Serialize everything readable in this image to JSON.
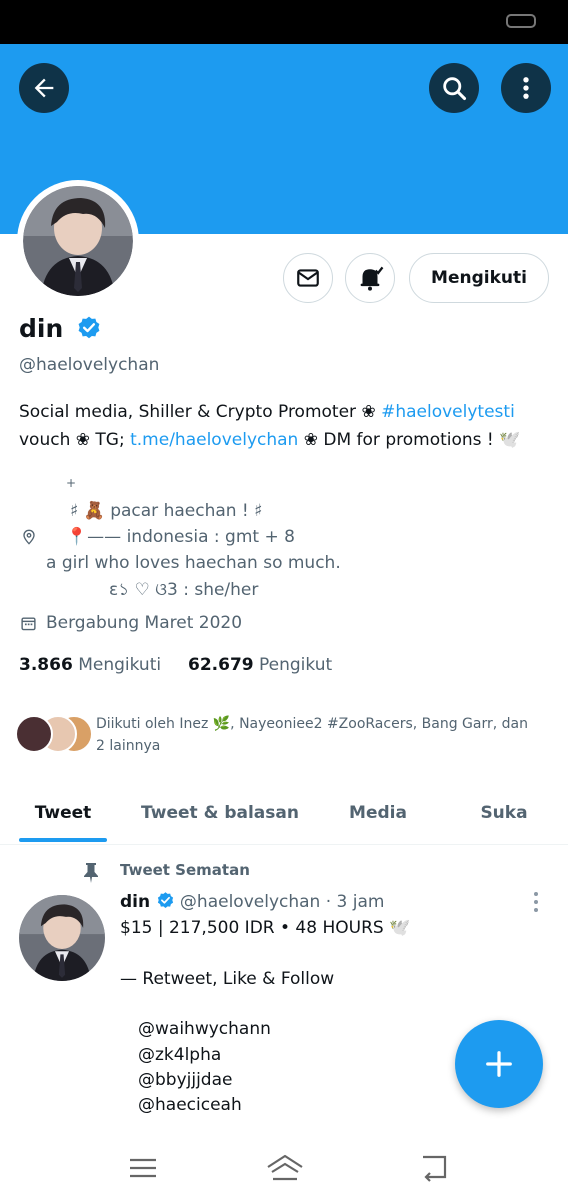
{
  "profile": {
    "name": "din",
    "handle": "@haelovelychan",
    "bio_line1_pre": "Social media, Shiller & Crypto Promoter ❀ ",
    "bio_hashtag": "#haelovelytesti",
    "bio_line2_pre": "vouch ❀ TG; ",
    "bio_link": "t.me/haelovelychan",
    "bio_line2_post": " ❀ DM for promotions ! 🕊️",
    "location_lines": [
      "+",
      "♯ 🧸 pacar  haechan ! ♯",
      "📍—— indonesia : gmt + 8",
      "a girl who loves haechan so much.",
      "ɛ১ ♡ ଓ3 : she/her"
    ],
    "joined": "Bergabung Maret 2020",
    "following_count": "3.866",
    "following_label": "Mengikuti",
    "followers_count": "62.679",
    "followers_label": "Pengikut",
    "followed_by": "Diikuti oleh Inez 🌿, Nayeoniee2 #ZooRacers, Bang Garr, dan",
    "followed_by_2": "2 lainnya"
  },
  "buttons": {
    "follow_label": "Mengikuti"
  },
  "tabs": [
    {
      "label": "Tweet"
    },
    {
      "label": "Tweet & balasan"
    },
    {
      "label": "Media"
    },
    {
      "label": "Suka"
    }
  ],
  "pinned": {
    "label": "Tweet Sematan",
    "name": "din",
    "handle_time": "@haelovelychan · 3 jam",
    "line1": "$15 | 217,500 IDR • 48 HOURS 🕊️",
    "line2": "— Retweet, Like & Follow",
    "mentions": [
      "@waihwychann",
      "@zk4lpha",
      "@bbyjjjdae",
      "@haeciceah"
    ]
  },
  "colors": {
    "accent": "#1d9bf0",
    "dark_button": "#0f3348"
  },
  "icons": [
    "back-arrow-icon",
    "search-icon",
    "more-vertical-icon",
    "mail-icon",
    "bell-icon",
    "verified-icon",
    "location-icon",
    "calendar-icon",
    "pin-icon",
    "plus-icon",
    "menu-icon",
    "home-icon",
    "back-nav-icon"
  ]
}
